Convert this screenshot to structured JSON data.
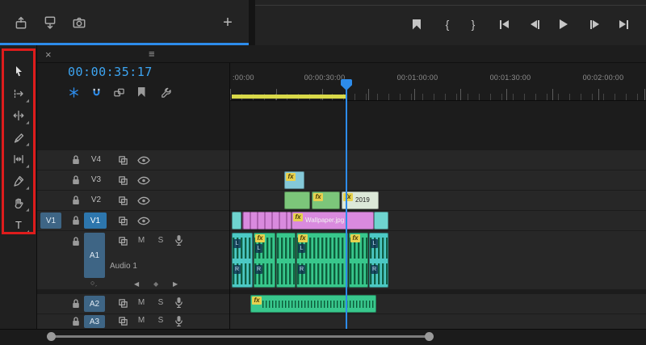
{
  "colors": {
    "accent_blue": "#2d8ceb",
    "timecode_blue": "#3da5f2",
    "clip_pink": "#d98ade",
    "clip_green": "#7cc67a",
    "clip_teal": "#6fd4cf",
    "audio_green": "#38c78c",
    "audio_teal": "#4cc9c4",
    "fx_yellow": "#e6d14f",
    "work_area_yellow": "#d9d949",
    "annotation_red": "#de1c1c"
  },
  "top_bar": {
    "buttons": [
      "lift",
      "extract",
      "export-frame"
    ],
    "add_button": "+",
    "transport": {
      "add_marker": "add-marker",
      "mark_in": "{",
      "mark_out": "}",
      "go_to_in": "go-to-in",
      "step_back": "step-back",
      "play": "play",
      "step_forward": "step-forward",
      "go_to_out": "go-to-out"
    }
  },
  "timeline": {
    "tab": {
      "close": "×",
      "menu": "≡"
    },
    "timecode": "00:00:35:17",
    "toolbar": [
      "nest-toggle",
      "snap",
      "linked-selection",
      "add-marker",
      "settings"
    ],
    "tools": [
      "selection",
      "track-select-forward",
      "ripple-edit",
      "razor",
      "slip",
      "pen",
      "hand",
      "type"
    ],
    "type_tool_label": "T",
    "ruler_labels": [
      ":00:00",
      "00:00:30:00",
      "00:01:00:00",
      "00:01:30:00",
      "00:02:00:00"
    ],
    "video_tracks": [
      {
        "name": "V4"
      },
      {
        "name": "V3"
      },
      {
        "name": "V2"
      },
      {
        "name": "V1",
        "source": "V1"
      }
    ],
    "audio_tracks": [
      {
        "name": "A1",
        "label": "Audio 1"
      },
      {
        "name": "A2"
      },
      {
        "name": "A3"
      }
    ],
    "track_labels": {
      "mute": "M",
      "solo": "S"
    },
    "keyframe_controls": {
      "add": "○",
      "prev": "◀",
      "diamond": "◆",
      "next": "▶"
    },
    "clips": {
      "fx_badge": "fx",
      "wallpaper": "Wallpaper.jpg",
      "year": "2019",
      "left": "L",
      "right": "R"
    }
  }
}
